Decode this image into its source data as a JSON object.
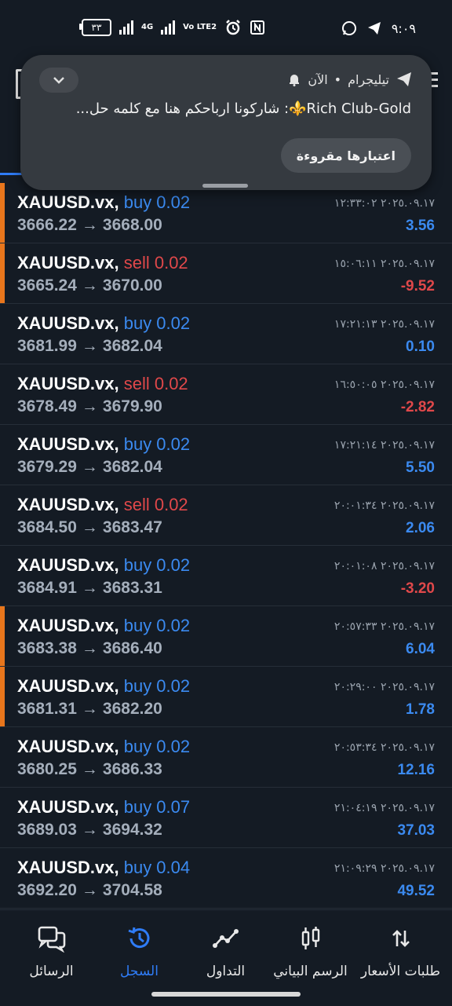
{
  "status_bar": {
    "battery": "٣٣",
    "network_left": "4G",
    "network_right": "Vo LTE2",
    "time": "٩:٠٩"
  },
  "notification": {
    "app": "تيليجرام",
    "separator": "•",
    "time": "الآن",
    "message": "Rich Club-Gold⚜️: شاركونا ارباحكم هنا مع كلمه حل...",
    "action": "اعتبارها مقروءة",
    "icons": [
      "telegram-icon",
      "bell-icon",
      "chevron-down-icon"
    ]
  },
  "trades": [
    {
      "symbol": "XAUUSD.vx,",
      "side": "buy",
      "side_label": "buy 0.02",
      "open": "3666.22",
      "close": "3668.00",
      "date": "٢٠٢٥.٠٩.١٧ ١٢:٣٣:٠٢",
      "profit": "3.56",
      "profit_sign": "pos",
      "marked": true
    },
    {
      "symbol": "XAUUSD.vx,",
      "side": "sell",
      "side_label": "sell 0.02",
      "open": "3665.24",
      "close": "3670.00",
      "date": "٢٠٢٥.٠٩.١٧ ١٥:٠٦:١١",
      "profit": "-9.52",
      "profit_sign": "neg",
      "marked": true
    },
    {
      "symbol": "XAUUSD.vx,",
      "side": "buy",
      "side_label": "buy 0.02",
      "open": "3681.99",
      "close": "3682.04",
      "date": "٢٠٢٥.٠٩.١٧ ١٧:٢١:١٣",
      "profit": "0.10",
      "profit_sign": "pos",
      "marked": false
    },
    {
      "symbol": "XAUUSD.vx,",
      "side": "sell",
      "side_label": "sell 0.02",
      "open": "3678.49",
      "close": "3679.90",
      "date": "٢٠٢٥.٠٩.١٧ ١٦:٥٠:٠٥",
      "profit": "-2.82",
      "profit_sign": "neg",
      "marked": false
    },
    {
      "symbol": "XAUUSD.vx,",
      "side": "buy",
      "side_label": "buy 0.02",
      "open": "3679.29",
      "close": "3682.04",
      "date": "٢٠٢٥.٠٩.١٧ ١٧:٢١:١٤",
      "profit": "5.50",
      "profit_sign": "pos",
      "marked": false
    },
    {
      "symbol": "XAUUSD.vx,",
      "side": "sell",
      "side_label": "sell 0.02",
      "open": "3684.50",
      "close": "3683.47",
      "date": "٢٠٢٥.٠٩.١٧ ٢٠:٠١:٣٤",
      "profit": "2.06",
      "profit_sign": "pos",
      "marked": false
    },
    {
      "symbol": "XAUUSD.vx,",
      "side": "buy",
      "side_label": "buy 0.02",
      "open": "3684.91",
      "close": "3683.31",
      "date": "٢٠٢٥.٠٩.١٧ ٢٠:٠١:٠٨",
      "profit": "-3.20",
      "profit_sign": "neg",
      "marked": false
    },
    {
      "symbol": "XAUUSD.vx,",
      "side": "buy",
      "side_label": "buy 0.02",
      "open": "3683.38",
      "close": "3686.40",
      "date": "٢٠٢٥.٠٩.١٧ ٢٠:٥٧:٣٣",
      "profit": "6.04",
      "profit_sign": "pos",
      "marked": true
    },
    {
      "symbol": "XAUUSD.vx,",
      "side": "buy",
      "side_label": "buy 0.02",
      "open": "3681.31",
      "close": "3682.20",
      "date": "٢٠٢٥.٠٩.١٧ ٢٠:٢٩:٠٠",
      "profit": "1.78",
      "profit_sign": "pos",
      "marked": true
    },
    {
      "symbol": "XAUUSD.vx,",
      "side": "buy",
      "side_label": "buy 0.02",
      "open": "3680.25",
      "close": "3686.33",
      "date": "٢٠٢٥.٠٩.١٧ ٢٠:٥٣:٣٤",
      "profit": "12.16",
      "profit_sign": "pos",
      "marked": false
    },
    {
      "symbol": "XAUUSD.vx,",
      "side": "buy",
      "side_label": "buy 0.07",
      "open": "3689.03",
      "close": "3694.32",
      "date": "٢٠٢٥.٠٩.١٧ ٢١:٠٤:١٩",
      "profit": "37.03",
      "profit_sign": "pos",
      "marked": false
    },
    {
      "symbol": "XAUUSD.vx,",
      "side": "buy",
      "side_label": "buy 0.04",
      "open": "3692.20",
      "close": "3704.58",
      "date": "٢٠٢٥.٠٩.١٧ ٢١:٠٩:٢٩",
      "profit": "49.52",
      "profit_sign": "pos",
      "marked": false
    }
  ],
  "arrow_glyph": "→",
  "bottom_nav": [
    {
      "label": "طلبات الأسعار",
      "icon": "quotes-icon",
      "active": false
    },
    {
      "label": "الرسم البياني",
      "icon": "chart-icon",
      "active": false
    },
    {
      "label": "التداول",
      "icon": "trade-icon",
      "active": false
    },
    {
      "label": "السجل",
      "icon": "history-icon",
      "active": true
    },
    {
      "label": "الرسائل",
      "icon": "messages-icon",
      "active": false
    }
  ],
  "colors": {
    "background": "#141b24",
    "buy": "#3b8af0",
    "sell": "#e0484a",
    "marker": "#e8761c",
    "active_nav": "#2f7cf6"
  }
}
